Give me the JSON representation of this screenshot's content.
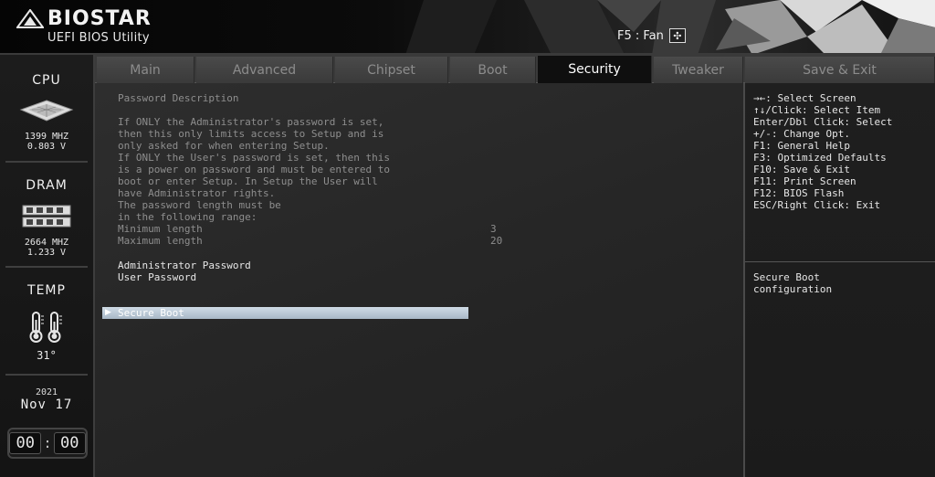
{
  "header": {
    "brand_name": "BIOSTAR",
    "brand_sub": "UEFI BIOS Utility",
    "fan_hint": "F5 : Fan",
    "fan_icon": "fan-icon"
  },
  "sidebar": {
    "cpu": {
      "title": "CPU",
      "freq": "1399 MHZ",
      "volt": "0.803 V"
    },
    "dram": {
      "title": "DRAM",
      "freq": "2664 MHZ",
      "volt": "1.233 V"
    },
    "temp": {
      "title": "TEMP",
      "value": "31°"
    },
    "date": {
      "year": "2021",
      "month_day": "Nov 17"
    },
    "clock": {
      "hours": "00",
      "minutes": "00"
    }
  },
  "tabs": [
    {
      "label": "Main"
    },
    {
      "label": "Advanced"
    },
    {
      "label": "Chipset"
    },
    {
      "label": "Boot"
    },
    {
      "label": "Security",
      "active": true
    },
    {
      "label": "Tweaker"
    },
    {
      "label": "Save & Exit"
    }
  ],
  "main": {
    "desc_title": "Password Description",
    "desc_lines": [
      "If ONLY the Administrator's password is set,",
      "then this only limits access to Setup and is",
      "only asked for when entering Setup.",
      "If ONLY the User's password is set, then this",
      "is a power on password and must be entered to",
      "boot or enter Setup. In Setup the User will",
      "have Administrator rights.",
      "The password length must be",
      "in the following range:"
    ],
    "min_label": "Minimum length",
    "min_value": "3",
    "max_label": "Maximum length",
    "max_value": "20",
    "admin_password": "Administrator Password",
    "user_password": "User Password",
    "secure_boot": "Secure Boot"
  },
  "help": {
    "keys": [
      "→←: Select Screen",
      "↑↓/Click: Select Item",
      "Enter/Dbl Click: Select",
      "+/-: Change Opt.",
      "F1: General Help",
      "F3: Optimized Defaults",
      "F10: Save & Exit",
      "F11: Print Screen",
      "F12: BIOS Flash",
      "ESC/Right Click: Exit"
    ],
    "description": [
      "Secure Boot",
      "configuration"
    ]
  }
}
